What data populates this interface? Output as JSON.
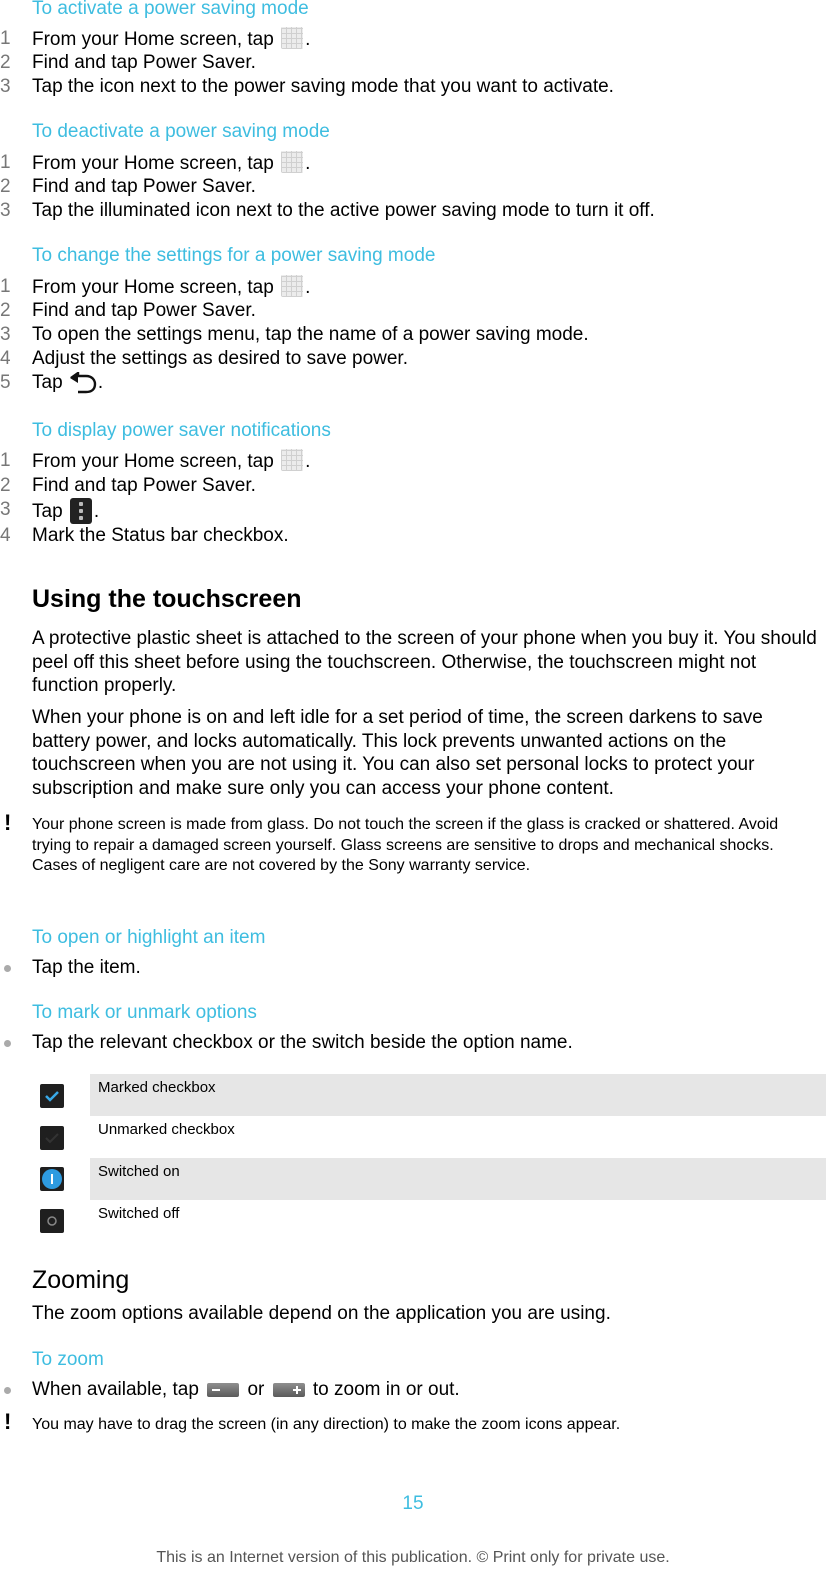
{
  "sections": [
    {
      "heading": "To activate a power saving mode",
      "steps": [
        {
          "num": "1",
          "pre": "From your Home screen, tap ",
          "icon": "apps-grid-icon",
          "post": "."
        },
        {
          "num": "2",
          "pre": "Find and tap ",
          "bold": "Power Saver",
          "post": "."
        },
        {
          "num": "3",
          "pre": "Tap the icon next to the power saving mode that you want to activate."
        }
      ]
    },
    {
      "heading": "To deactivate a power saving mode",
      "steps": [
        {
          "num": "1",
          "pre": "From your Home screen, tap ",
          "icon": "apps-grid-icon",
          "post": "."
        },
        {
          "num": "2",
          "pre": "Find and tap ",
          "bold": "Power Saver",
          "post": "."
        },
        {
          "num": "3",
          "pre": "Tap the illuminated icon next to the active power saving mode to turn it off."
        }
      ]
    },
    {
      "heading": "To change the settings for a power saving mode",
      "steps": [
        {
          "num": "1",
          "pre": "From your Home screen, tap ",
          "icon": "apps-grid-icon",
          "post": "."
        },
        {
          "num": "2",
          "pre": "Find and tap ",
          "bold": "Power Saver",
          "post": "."
        },
        {
          "num": "3",
          "pre": "To open the settings menu, tap the name of a power saving mode."
        },
        {
          "num": "4",
          "pre": "Adjust the settings as desired to save power."
        },
        {
          "num": "5",
          "pre": "Tap ",
          "icon": "back-icon",
          "post": "."
        }
      ]
    },
    {
      "heading": "To display power saver notifications",
      "steps": [
        {
          "num": "1",
          "pre": "From your Home screen, tap ",
          "icon": "apps-grid-icon",
          "post": "."
        },
        {
          "num": "2",
          "pre": "Find and tap ",
          "bold": "Power Saver",
          "post": "."
        },
        {
          "num": "3",
          "pre": "Tap ",
          "icon": "menu-icon",
          "post": "."
        },
        {
          "num": "4",
          "pre": "Mark the ",
          "bold": "Status bar",
          "post": " checkbox."
        }
      ]
    }
  ],
  "touchscreen": {
    "title": "Using the touchscreen",
    "para1": "A protective plastic sheet is attached to the screen of your phone when you buy it. You should peel off this sheet before using the touchscreen. Otherwise, the touchscreen might not function properly.",
    "para2": "When your phone is on and left idle for a set period of time, the screen darkens to save battery power, and locks automatically. This lock prevents unwanted actions on the touchscreen when you are not using it. You can also set personal locks to protect your subscription and make sure only you can access your phone content.",
    "note_symbol": "!",
    "note": "Your phone screen is made from glass. Do not touch the screen if the glass is cracked or shattered. Avoid trying to repair a damaged screen yourself. Glass screens are sensitive to drops and mechanical shocks. Cases of negligent care are not covered by the Sony warranty service.",
    "open_heading": "To open or highlight an item",
    "open_bullet": "Tap the item.",
    "mark_heading": "To mark or unmark options",
    "mark_bullet": "Tap the relevant checkbox or the switch beside the option name.",
    "options": [
      {
        "label": "Marked checkbox",
        "icon": "checkbox-marked-icon"
      },
      {
        "label": "Unmarked checkbox",
        "icon": "checkbox-unmarked-icon"
      },
      {
        "label": "Switched on",
        "icon": "switch-on-icon"
      },
      {
        "label": "Switched off",
        "icon": "switch-off-icon"
      }
    ]
  },
  "zooming": {
    "title": "Zooming",
    "intro": "The zoom options available depend on the application you are using.",
    "heading": "To zoom",
    "bullet_pre": "When available, tap ",
    "bullet_mid": " or ",
    "bullet_post": " to zoom in or out.",
    "note_symbol": "!",
    "note": "You may have to drag the screen (in any direction) to make the zoom icons appear."
  },
  "footer": {
    "page_number": "15",
    "note": "This is an Internet version of this publication. © Print only for private use."
  },
  "colors": {
    "heading": "#3ebde0",
    "switch_on": "#2e9be0"
  }
}
